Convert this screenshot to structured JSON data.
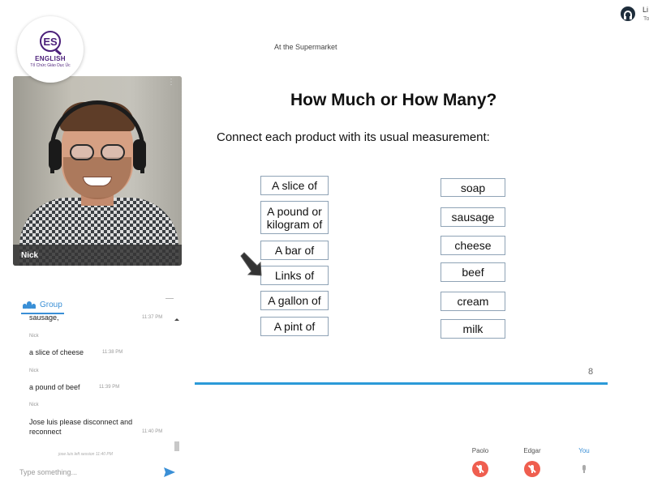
{
  "logo": {
    "monogram": "ES",
    "name": "ENGLISH",
    "subtitle": "Tổ Chức Giáo Dục Úc",
    "color": "#4b1f7a"
  },
  "video": {
    "participant_name": "Nick"
  },
  "chat": {
    "tab_label": "Group",
    "input_placeholder": "Type something...",
    "messages": [
      {
        "sender": "",
        "text": "sausage,",
        "time": "11:37 PM"
      },
      {
        "sender": "Nick",
        "text": "a slice of cheese",
        "time": "11:38 PM"
      },
      {
        "sender": "Nick",
        "text": "a pound of beef",
        "time": "11:39 PM"
      },
      {
        "sender": "Nick",
        "text": "Jose luis please disconnect and reconnect",
        "time": "11:40 PM"
      }
    ],
    "session_note": "jose luis left session 11:40 PM"
  },
  "slide": {
    "subtitle": "At the Supermarket",
    "title": "How Much or How Many?",
    "instruction": "Connect each product with its usual measurement:",
    "measurements": [
      "A slice of",
      "A pound or kilogram of",
      "A bar of",
      "Links of",
      "A gallon of",
      "A pint of"
    ],
    "products": [
      "soap",
      "sausage",
      "cheese",
      "beef",
      "cream",
      "milk"
    ],
    "page_number": "8",
    "accent_color": "#2b9ad8"
  },
  "participants": [
    {
      "name": "Paolo",
      "mic": "off"
    },
    {
      "name": "Edgar",
      "mic": "off"
    },
    {
      "name": "You",
      "mic": "on"
    }
  ],
  "user": {
    "name": "Li",
    "sub": "To"
  }
}
